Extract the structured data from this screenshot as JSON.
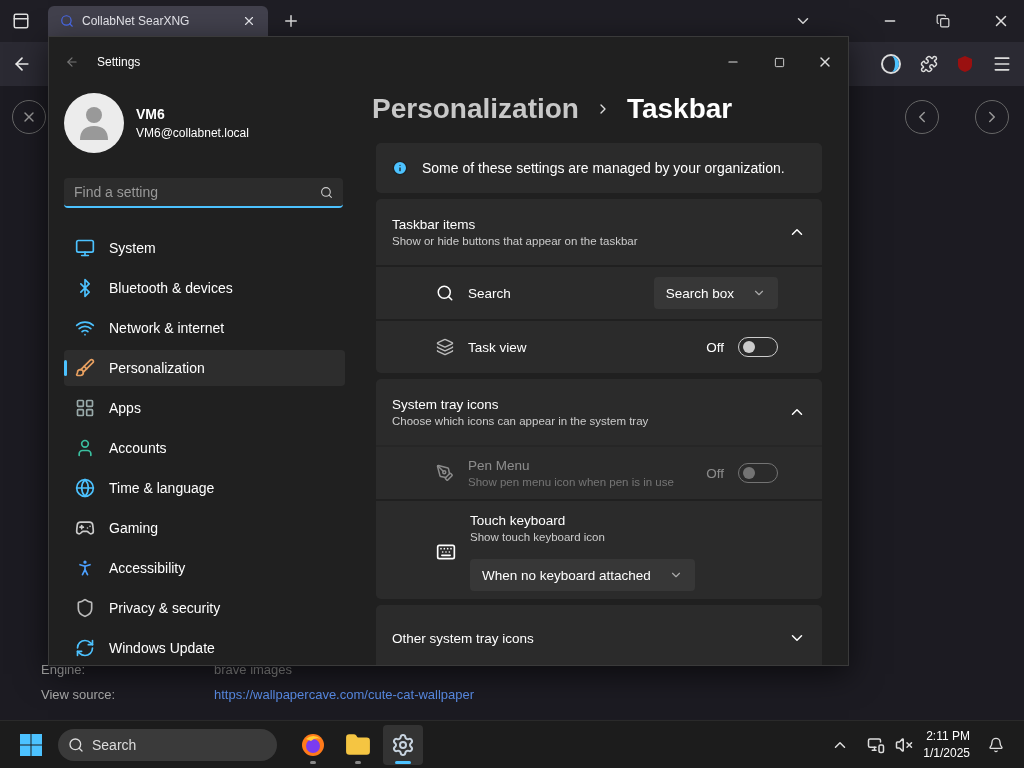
{
  "browser": {
    "tab": {
      "title": "CollabNet SearXNG",
      "selected": true
    },
    "details": [
      {
        "kind": "text",
        "label": "Engine:",
        "value": "brave images"
      },
      {
        "kind": "link",
        "label": "View source:",
        "value": "https://wallpapercave.com/cute-cat-wallpaper"
      }
    ]
  },
  "settings": {
    "title": "Settings",
    "user": {
      "name": "VM6",
      "email": "VM6@collabnet.local"
    },
    "search": {
      "placeholder": "Find a setting"
    },
    "nav": [
      {
        "label": "System",
        "selected": false
      },
      {
        "label": "Bluetooth & devices",
        "selected": false
      },
      {
        "label": "Network & internet",
        "selected": false
      },
      {
        "label": "Personalization",
        "selected": true
      },
      {
        "label": "Apps",
        "selected": false
      },
      {
        "label": "Accounts",
        "selected": false
      },
      {
        "label": "Time & language",
        "selected": false
      },
      {
        "label": "Gaming",
        "selected": false
      },
      {
        "label": "Accessibility",
        "selected": false
      },
      {
        "label": "Privacy & security",
        "selected": false
      },
      {
        "label": "Windows Update",
        "selected": false
      }
    ],
    "breadcrumb": {
      "parent": "Personalization",
      "current": "Taskbar"
    },
    "notice": "Some of these settings are managed by your organization.",
    "sections": [
      {
        "title": "Taskbar items",
        "subtitle": "Show or hide buttons that appear on the taskbar",
        "expanded": true,
        "rows": [
          {
            "kind": "dropdown",
            "label": "Search",
            "value": "Search box",
            "disabled": false
          },
          {
            "kind": "toggle",
            "label": "Task view",
            "state_text": "Off",
            "on": false,
            "disabled": false
          }
        ]
      },
      {
        "title": "System tray icons",
        "subtitle": "Choose which icons can appear in the system tray",
        "expanded": true,
        "rows": [
          {
            "kind": "toggle",
            "label": "Pen Menu",
            "subtitle": "Show pen menu icon when pen is in use",
            "state_text": "Off",
            "on": false,
            "disabled": true
          },
          {
            "kind": "dropdown_below",
            "label": "Touch keyboard",
            "subtitle": "Show touch keyboard icon",
            "value": "When no keyboard attached",
            "disabled": false
          }
        ]
      },
      {
        "title": "Other system tray icons",
        "expanded": false
      }
    ]
  },
  "taskbar": {
    "search_placeholder": "Search",
    "apps": [
      {
        "kind": "browser",
        "active": false
      },
      {
        "kind": "files",
        "active": false
      },
      {
        "kind": "settings",
        "active": true
      }
    ],
    "time": "2:11 PM",
    "date": "1/1/2025"
  }
}
